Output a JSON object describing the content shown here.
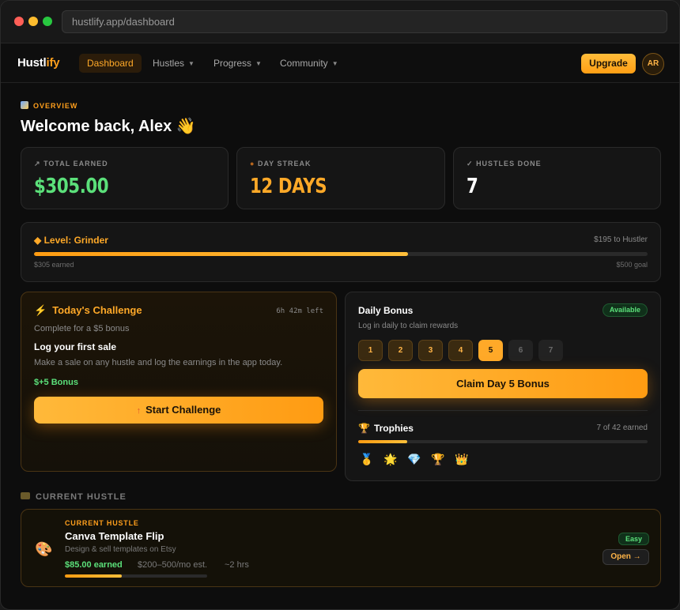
{
  "browser": {
    "url": "hustlify.app/dashboard"
  },
  "nav": {
    "logo_a": "Hustl",
    "logo_b": "ify",
    "items": [
      {
        "label": "Dashboard"
      },
      {
        "label": "Hustles"
      },
      {
        "label": "Progress"
      },
      {
        "label": "Community"
      }
    ],
    "upgrade": "Upgrade",
    "avatar_initials": "AR"
  },
  "overview": {
    "eyebrow": "OVERVIEW",
    "title": "Welcome back, Alex 👋"
  },
  "stats": [
    {
      "icon": "↗",
      "label": "TOTAL EARNED",
      "value": "$305.00",
      "color": "#5be07a"
    },
    {
      "icon": "●",
      "label": "DAY STREAK",
      "value": "12 DAYS",
      "color": "#ffa928"
    },
    {
      "icon": "✓",
      "label": "HUSTLES DONE",
      "value": "7",
      "color": "#ffffff"
    }
  ],
  "level": {
    "title": "◆ Level: Grinder",
    "to_next": "$195 to Hustler",
    "earned": "$305 earned",
    "goal": "$500 goal",
    "progress": 0.61
  },
  "challenge": {
    "title": "Today's Challenge",
    "time_left": "6h 42m left",
    "subtitle": "Complete for a $5 bonus",
    "task": "Log your first sale",
    "description": "Make a sale on any hustle and log the earnings in the app today.",
    "bonus": "$+5 Bonus",
    "button": "Start Challenge"
  },
  "daily_bonus": {
    "title": "Daily Bonus",
    "badge": "Available",
    "subtitle": "Log in daily to claim rewards",
    "days": [
      "1",
      "2",
      "3",
      "4",
      "5",
      "6",
      "7"
    ],
    "claimed_days": 4,
    "current_day": 5,
    "button": "Claim Day 5 Bonus"
  },
  "trophies": {
    "title": "Trophies",
    "count": "7 of 42 earned",
    "progress": 0.17,
    "icons": [
      "🥇",
      "🌟",
      "💎",
      "🏆",
      "👑"
    ]
  },
  "current_hustle": {
    "section_label": "CURRENT HUSTLE",
    "eyebrow": "CURRENT HUSTLE",
    "icon": "🎨",
    "name": "Canva Template Flip",
    "description": "Design & sell templates on Etsy",
    "earned": "$85.00 earned",
    "estimate": "$200–500/mo est.",
    "time": "~2 hrs",
    "difficulty": "Easy",
    "open": "Open →",
    "progress": 0.4
  }
}
